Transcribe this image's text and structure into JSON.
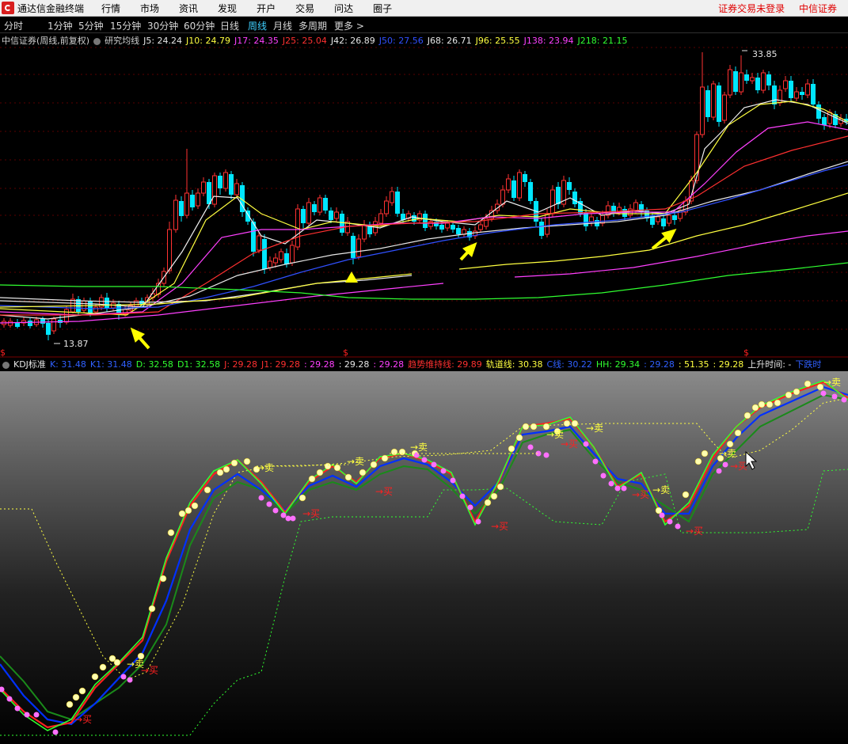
{
  "menubar": {
    "app_title": "通达信金融终端",
    "items": [
      "行情",
      "市场",
      "资讯",
      "发现",
      "开户",
      "交易",
      "问达",
      "圈子"
    ],
    "right_items": [
      "证券交易未登录",
      "中信证券"
    ]
  },
  "periods": {
    "items": [
      "分时",
      "1分钟",
      "5分钟",
      "15分钟",
      "30分钟",
      "60分钟",
      "日线",
      "周线",
      "月线",
      "多周期",
      "更多 >"
    ],
    "active": "周线"
  },
  "ma_header": {
    "stock_title": "中信证券(周线,前复权)",
    "indicator_name": "研究均线",
    "values": [
      {
        "label": "J5: 24.24",
        "color": "#e6e6e6"
      },
      {
        "label": "J10: 24.79",
        "color": "#ffff40"
      },
      {
        "label": "J17: 24.35",
        "color": "#ff40ff"
      },
      {
        "label": "J25: 25.04",
        "color": "#ff3030"
      },
      {
        "label": "J42: 26.89",
        "color": "#e6e6e6"
      },
      {
        "label": "J50: 27.56",
        "color": "#3050ff"
      },
      {
        "label": "J68: 26.71",
        "color": "#e6e6e6"
      },
      {
        "label": "J96: 25.55",
        "color": "#ffff40"
      },
      {
        "label": "J138: 23.94",
        "color": "#ff40ff"
      },
      {
        "label": "J218: 21.15",
        "color": "#30ff30"
      }
    ]
  },
  "price_chart": {
    "high_label": "33.85",
    "low_label": "13.87",
    "marker": "$"
  },
  "kdj_header": {
    "indicator_name": "KDJ标准",
    "values": [
      {
        "label": "K: 31.48",
        "color": "#3060ff"
      },
      {
        "label": "K1: 31.48",
        "color": "#3060ff"
      },
      {
        "label": "D: 32.58",
        "color": "#30ff30"
      },
      {
        "label": "D1: 32.58",
        "color": "#30ff30"
      },
      {
        "label": "J: 29.28",
        "color": "#ff3030"
      },
      {
        "label": "J1: 29.28",
        "color": "#ff3030"
      },
      {
        "label": ": 29.28",
        "color": "#ff40ff"
      },
      {
        "label": ": 29.28",
        "color": "#e6e6e6"
      },
      {
        "label": ": 29.28",
        "color": "#ff40ff"
      },
      {
        "label": "趋势维持线: 29.89",
        "color": "#ff3030"
      },
      {
        "label": "轨道线: 30.38",
        "color": "#ffff40"
      },
      {
        "label": "C线: 30.22",
        "color": "#3060ff"
      },
      {
        "label": "HH: 29.34",
        "color": "#30ff30"
      },
      {
        "label": ": 29.28",
        "color": "#3060ff"
      },
      {
        "label": ": 51.35",
        "color": "#ffff40"
      },
      {
        "label": ": 29.28",
        "color": "#ffff40"
      },
      {
        "label": "上升时间: -",
        "color": "#e6e6e6"
      },
      {
        "label": "下跌时",
        "color": "#3060ff"
      }
    ]
  },
  "kdj_signals": {
    "sell": "→卖",
    "buy": "→买"
  },
  "colors": {
    "up": "#ff3232",
    "down": "#00e6ff",
    "k": "#0030ff",
    "d": "#1a9a1a",
    "j": "#ff2020",
    "sell": "#ffff00",
    "buy": "#ff2020"
  }
}
